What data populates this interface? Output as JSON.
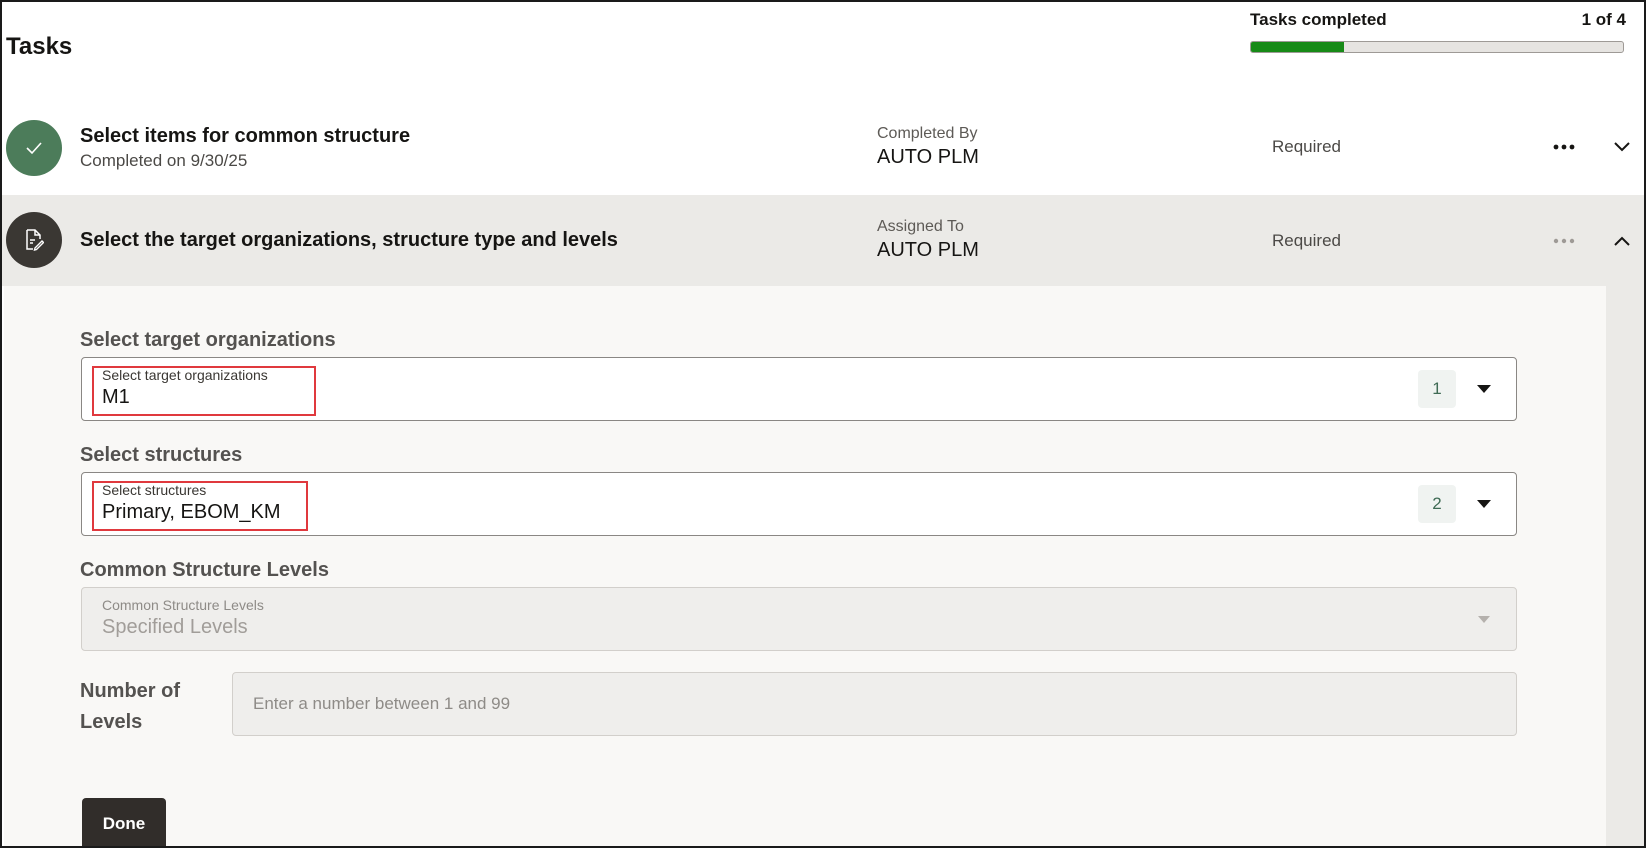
{
  "header": {
    "title": "Tasks",
    "progress_label": "Tasks completed",
    "progress_count": "1 of 4",
    "progress_fraction": 0.25
  },
  "tasks": [
    {
      "title": "Select items for common structure",
      "subtitle": "Completed on 9/30/25",
      "meta_label": "Completed By",
      "meta_value": "AUTO PLM",
      "requirement": "Required",
      "status_icon": "check-icon",
      "expanded": false
    },
    {
      "title": "Select the target organizations, structure type and levels",
      "meta_label": "Assigned To",
      "meta_value": "AUTO PLM",
      "requirement": "Required",
      "status_icon": "document-edit-icon",
      "expanded": true
    }
  ],
  "form": {
    "target_orgs": {
      "section_label": "Select target organizations",
      "inner_label": "Select target organizations",
      "value": "M1",
      "count": "1"
    },
    "structures": {
      "section_label": "Select structures",
      "inner_label": "Select structures",
      "value": "Primary, EBOM_KM",
      "count": "2"
    },
    "levels_type": {
      "section_label": "Common Structure Levels",
      "inner_label": "Common Structure Levels",
      "value": "Specified Levels"
    },
    "number_of_levels": {
      "label": "Number of Levels",
      "placeholder": "Enter a number between 1 and 99",
      "value": ""
    },
    "done_label": "Done"
  },
  "colors": {
    "progress_fill": "#178a17",
    "completed_icon_bg": "#4c7c5a",
    "active_icon_bg": "#3a3733",
    "highlight_border": "#e0393e",
    "primary_button": "#312d2a"
  }
}
